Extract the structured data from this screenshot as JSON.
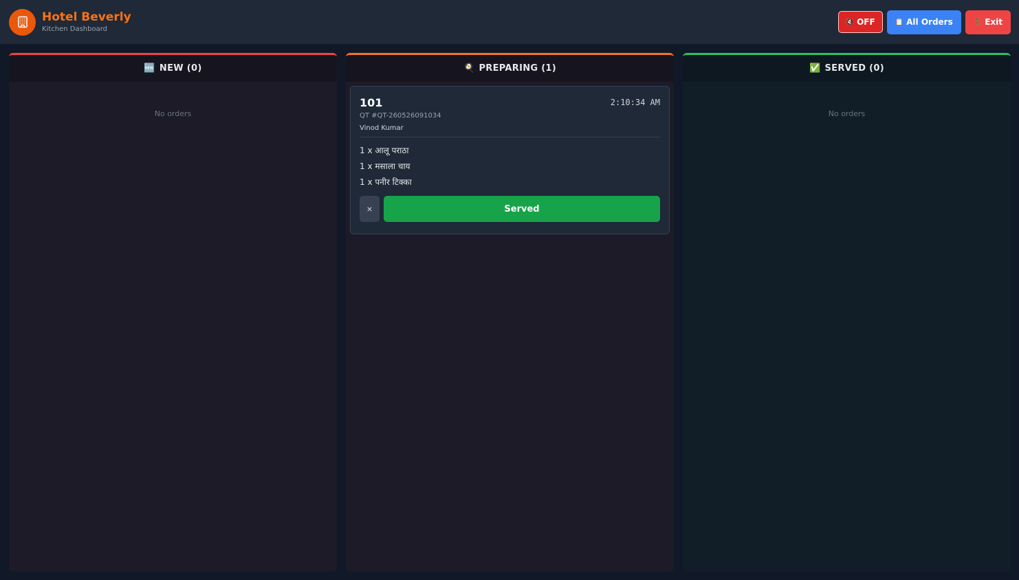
{
  "header": {
    "title": "Hotel Beverly",
    "subtitle": "Kitchen Dashboard",
    "sound_button": {
      "icon": "🔇",
      "label": "OFF"
    },
    "orders_button": {
      "icon": "📋",
      "label": "All Orders"
    },
    "exit_button": {
      "icon": "🚪",
      "label": "Exit"
    }
  },
  "columns": {
    "new": {
      "icon": "🆕",
      "label": "NEW (0)",
      "empty_text": "No orders"
    },
    "preparing": {
      "icon": "🍳",
      "label": "PREPARING (1)",
      "orders": [
        {
          "table": "101",
          "time": "2:10:34 AM",
          "ref": "QT #QT-260526091034",
          "customer": "Vinod Kumar",
          "items": [
            "1 x आलू पराठा",
            "1 x मसाला चाय",
            "1 x पनीर टिक्का"
          ],
          "cancel_label": "×",
          "served_label": "Served"
        }
      ]
    },
    "served": {
      "icon": "✅",
      "label": "SERVED (0)",
      "empty_text": "No orders"
    }
  },
  "colors": {
    "brand": "#f97316",
    "new_accent": "#ef4444",
    "preparing_accent": "#f97316",
    "served_accent": "#22c55e",
    "served_button": "#16a34a"
  },
  "icons": {
    "logo": "building-icon"
  }
}
